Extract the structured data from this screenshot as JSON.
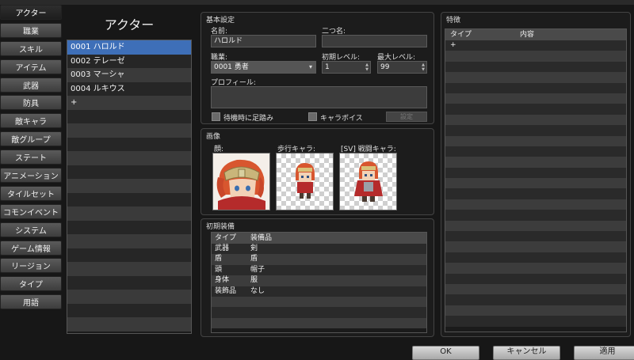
{
  "nav": {
    "items": [
      "アクター",
      "職業",
      "スキル",
      "アイテム",
      "武器",
      "防具",
      "敵キャラ",
      "敵グループ",
      "ステート",
      "アニメーション",
      "タイルセット",
      "コモンイベント",
      "システム",
      "ゲーム情報",
      "リージョン",
      "タイプ",
      "用語"
    ],
    "active_index": 0
  },
  "actors": {
    "title": "アクター",
    "items": [
      "0001 ハロルド",
      "0002 テレーゼ",
      "0003 マーシャ",
      "0004 ルキウス",
      "+"
    ],
    "selected_index": 0
  },
  "basic": {
    "title": "基本設定",
    "name_label": "名前:",
    "name_value": "ハロルド",
    "nickname_label": "二つ名:",
    "nickname_value": "",
    "class_label": "職業:",
    "class_value": "0001 勇者",
    "init_level_label": "初期レベル:",
    "init_level_value": "1",
    "max_level_label": "最大レベル:",
    "max_level_value": "99",
    "profile_label": "プロフィール:",
    "profile_value": "",
    "check_stepping": "待機時に足踏み",
    "check_voice": "キャラボイス",
    "settings_button": "設定"
  },
  "images": {
    "title": "画像",
    "face_label": "顔:",
    "walk_label": "歩行キャラ:",
    "battler_label": "[SV] 戦闘キャラ:"
  },
  "equipment": {
    "title": "初期装備",
    "headers": [
      "タイプ",
      "装備品"
    ],
    "rows": [
      [
        "武器",
        "剣"
      ],
      [
        "盾",
        "盾"
      ],
      [
        "頭",
        "帽子"
      ],
      [
        "身体",
        "服"
      ],
      [
        "装飾品",
        "なし"
      ]
    ]
  },
  "traits": {
    "title": "特徴",
    "headers": [
      "タイプ",
      "内容"
    ],
    "rows": [
      "+"
    ]
  },
  "footer": {
    "ok": "OK",
    "cancel": "キャンセル",
    "apply": "適用"
  }
}
